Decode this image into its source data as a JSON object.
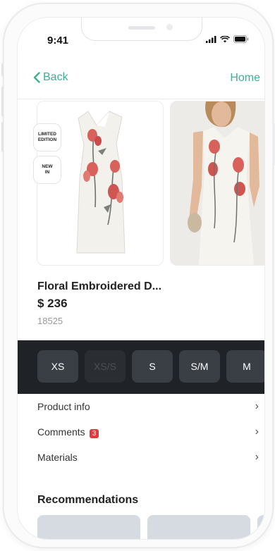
{
  "status": {
    "time": "9:41"
  },
  "nav": {
    "back_label": "Back",
    "home_label": "Home"
  },
  "badges": {
    "limited_line1": "LIMITED",
    "limited_line2": "EDITION",
    "new_line1": "NEW",
    "new_line2": "IN"
  },
  "product": {
    "title": "Floral Embroidered D...",
    "price": "$ 236",
    "sku": "18525"
  },
  "sizes": [
    {
      "label": "XS",
      "available": true
    },
    {
      "label": "XS/S",
      "available": false
    },
    {
      "label": "S",
      "available": true
    },
    {
      "label": "S/M",
      "available": true
    },
    {
      "label": "M",
      "available": true
    }
  ],
  "info_rows": [
    {
      "label": "Product info"
    },
    {
      "label": "Comments",
      "count": "3"
    },
    {
      "label": "Materials"
    }
  ],
  "recommendations": {
    "title": "Recommendations"
  },
  "colors": {
    "accent": "#3fae92",
    "size_bar": "#1f2226",
    "badge_red": "#e03a3a"
  }
}
